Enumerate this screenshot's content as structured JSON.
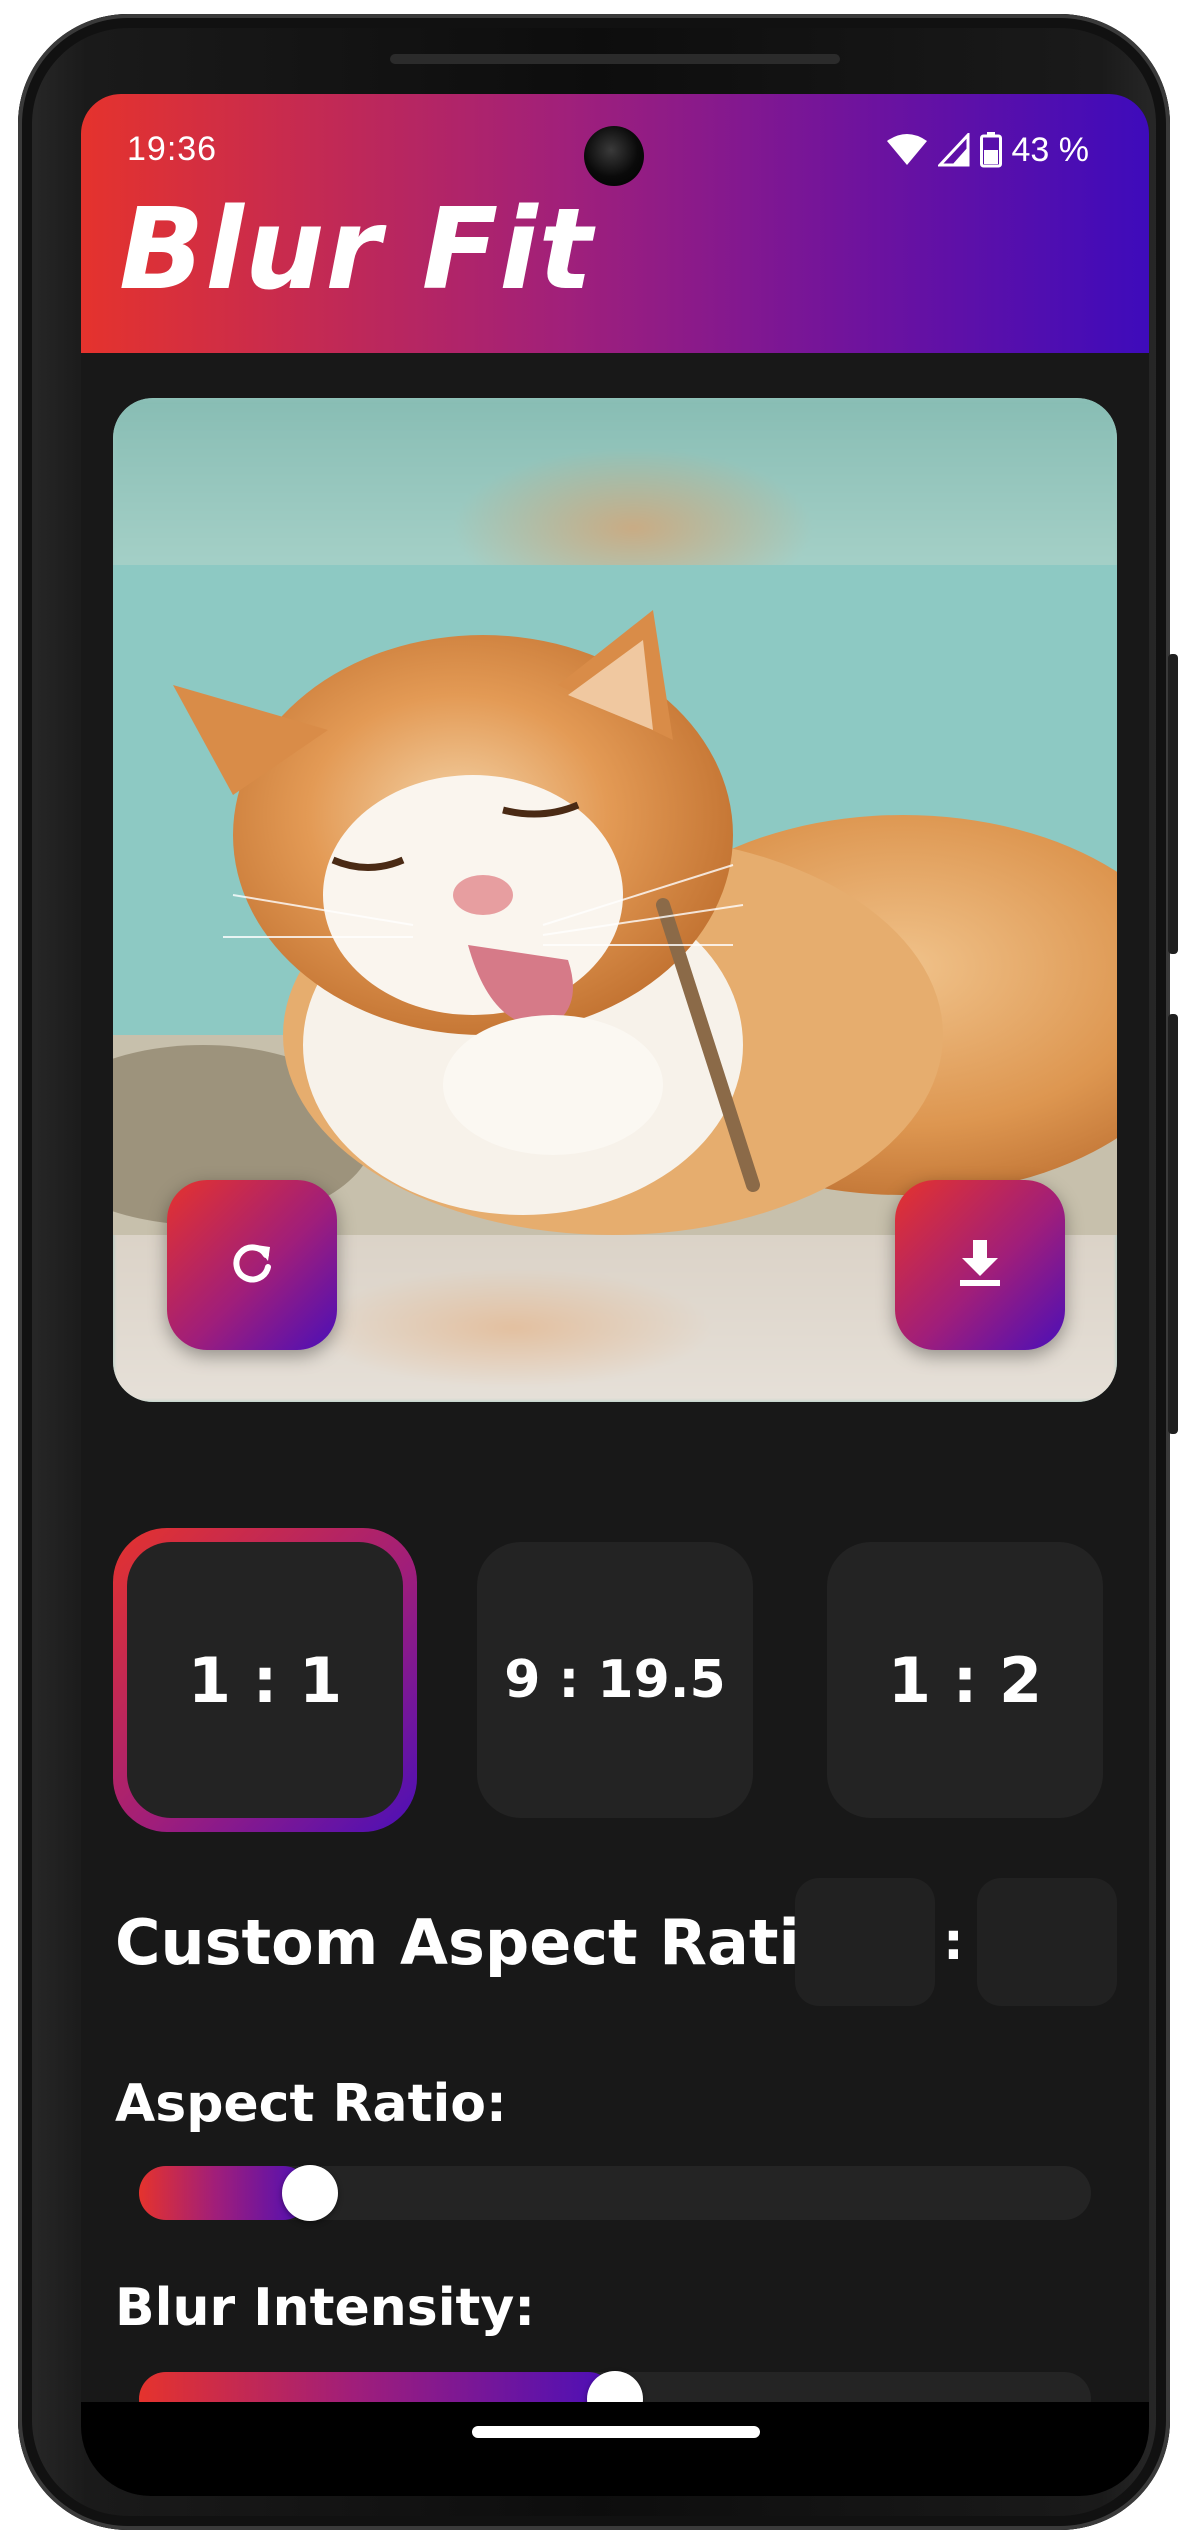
{
  "status_bar": {
    "time": "19:36",
    "battery": "43 %",
    "icons": [
      "wifi-icon",
      "cellular-signal-icon",
      "battery-icon"
    ]
  },
  "app": {
    "title": "Blur Fit"
  },
  "preview": {
    "refresh_icon": "refresh-icon",
    "download_icon": "download-icon"
  },
  "ratios": {
    "options": [
      "1 : 1",
      "9 : 19.5",
      "1 : 2"
    ],
    "selected_index": 0
  },
  "custom_ratio": {
    "label": "Custom Aspect Ratio:",
    "separator": ":",
    "width_value": "",
    "height_value": ""
  },
  "sliders": {
    "aspect_ratio": {
      "label": "Aspect Ratio:",
      "value_fraction": 0.18
    },
    "blur_intensity": {
      "label": "Blur Intensity:",
      "value_fraction": 0.5
    }
  },
  "colors": {
    "gradient_start": "#e5332d",
    "gradient_mid": "#a01e7a",
    "gradient_end": "#4b0fb8",
    "background": "#181818",
    "surface": "#232323"
  }
}
